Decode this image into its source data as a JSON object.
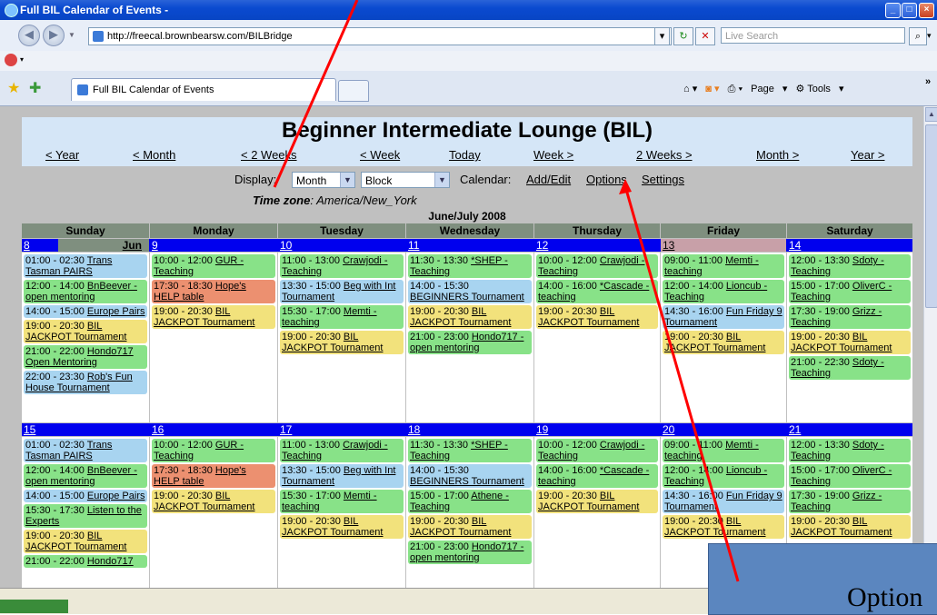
{
  "window": {
    "title": "Full BIL Calendar of Events -"
  },
  "address": {
    "url": "http://freecal.brownbearsw.com/BILBridge",
    "search_placeholder": "Live Search"
  },
  "tab": {
    "label": "Full BIL Calendar of Events"
  },
  "toolbar": {
    "page_label": "Page",
    "tools_label": "Tools"
  },
  "page": {
    "title": "Beginner Intermediate Lounge (BIL)",
    "nav": [
      "< Year",
      "< Month",
      "< 2 Weeks",
      "< Week",
      "Today",
      "Week >",
      "2 Weeks >",
      "Month >",
      "Year >"
    ],
    "display_label": "Display:",
    "display_value": "Month",
    "display_style": "Block",
    "calendar_label": "Calendar:",
    "calendar_links": [
      "Add/Edit",
      "Options",
      "Settings"
    ],
    "timezone_label": "Time zone",
    "timezone_value": ": America/New_York",
    "month_label": "June/July 2008",
    "day_names": [
      "Sunday",
      "Monday",
      "Tuesday",
      "Wednesday",
      "Thursday",
      "Friday",
      "Saturday"
    ]
  },
  "weeks": [
    {
      "dates": [
        "8",
        "9",
        "10",
        "11",
        "12",
        "13",
        "14"
      ],
      "month_tag": "Jun",
      "days": [
        [
          {
            "time": "01:00 - 02:30",
            "name": "Trans Tasman PAIRS",
            "color": "blue"
          },
          {
            "time": "12:00 - 14:00",
            "name": "BnBeever - open mentoring",
            "color": "green"
          },
          {
            "time": "14:00 - 15:00",
            "name": "Europe Pairs",
            "color": "blue"
          },
          {
            "time": "19:00 - 20:30",
            "name": "BIL JACKPOT Tournament",
            "color": "yellow"
          },
          {
            "time": "21:00 - 22:00",
            "name": "Hondo717 Open Mentoring",
            "color": "green"
          },
          {
            "time": "22:00 - 23:30",
            "name": "Rob's Fun House Tournament",
            "color": "blue"
          }
        ],
        [
          {
            "time": "10:00 - 12:00",
            "name": "GUR - Teaching",
            "color": "green"
          },
          {
            "time": "17:30 - 18:30",
            "name": "Hope's HELP table",
            "color": "salmon"
          },
          {
            "time": "19:00 - 20:30",
            "name": "BIL JACKPOT Tournament",
            "color": "yellow"
          }
        ],
        [
          {
            "time": "11:00 - 13:00",
            "name": "Crawjodi - Teaching",
            "color": "green"
          },
          {
            "time": "13:30 - 15:00",
            "name": "Beg with Int Tournament",
            "color": "blue"
          },
          {
            "time": "15:30 - 17:00",
            "name": "Memti - teaching",
            "color": "green"
          },
          {
            "time": "19:00 - 20:30",
            "name": "BIL JACKPOT Tournament",
            "color": "yellow"
          }
        ],
        [
          {
            "time": "11:30 - 13:30",
            "name": "*SHEP - Teaching",
            "color": "green"
          },
          {
            "time": "14:00 - 15:30",
            "name": "BEGINNERS Tournament",
            "color": "blue"
          },
          {
            "time": "19:00 - 20:30",
            "name": "BIL JACKPOT Tournament",
            "color": "yellow"
          },
          {
            "time": "21:00 - 23:00",
            "name": "Hondo717 - open mentoring",
            "color": "green"
          }
        ],
        [
          {
            "time": "10:00 - 12:00",
            "name": "Crawjodi - Teaching",
            "color": "green"
          },
          {
            "time": "14:00 - 16:00",
            "name": "*Cascade - teaching",
            "color": "green"
          },
          {
            "time": "19:00 - 20:30",
            "name": "BIL JACKPOT Tournament",
            "color": "yellow"
          }
        ],
        [
          {
            "time": "09:00 - 11:00",
            "name": "Memti - teaching",
            "color": "green"
          },
          {
            "time": "12:00 - 14:00",
            "name": "Lioncub - Teaching",
            "color": "green"
          },
          {
            "time": "14:30 - 16:00",
            "name": "Fun Friday 9 Tournament",
            "color": "blue"
          },
          {
            "time": "19:00 - 20:30",
            "name": "BIL JACKPOT Tournament",
            "color": "yellow"
          }
        ],
        [
          {
            "time": "12:00 - 13:30",
            "name": "Sdoty - Teaching",
            "color": "green"
          },
          {
            "time": "15:00 - 17:00",
            "name": "OliverC - Teaching",
            "color": "green"
          },
          {
            "time": "17:30 - 19:00",
            "name": "Grizz - Teaching",
            "color": "green"
          },
          {
            "time": "19:00 - 20:30",
            "name": "BIL JACKPOT Tournament",
            "color": "yellow"
          },
          {
            "time": "21:00 - 22:30",
            "name": "Sdoty - Teaching",
            "color": "green"
          }
        ]
      ]
    },
    {
      "dates": [
        "15",
        "16",
        "17",
        "18",
        "19",
        "20",
        "21"
      ],
      "days": [
        [
          {
            "time": "01:00 - 02:30",
            "name": "Trans Tasman PAIRS",
            "color": "blue"
          },
          {
            "time": "12:00 - 14:00",
            "name": "BnBeever - open mentoring",
            "color": "green"
          },
          {
            "time": "14:00 - 15:00",
            "name": "Europe Pairs",
            "color": "blue"
          },
          {
            "time": "15:30 - 17:30",
            "name": "Listen to the Experts",
            "color": "green"
          },
          {
            "time": "19:00 - 20:30",
            "name": "BIL JACKPOT Tournament",
            "color": "yellow"
          },
          {
            "time": "21:00 - 22:00",
            "name": "Hondo717",
            "color": "green"
          }
        ],
        [
          {
            "time": "10:00 - 12:00",
            "name": "GUR - Teaching",
            "color": "green"
          },
          {
            "time": "17:30 - 18:30",
            "name": "Hope's HELP table",
            "color": "salmon"
          },
          {
            "time": "19:00 - 20:30",
            "name": "BIL JACKPOT Tournament",
            "color": "yellow"
          }
        ],
        [
          {
            "time": "11:00 - 13:00",
            "name": "Crawjodi - Teaching",
            "color": "green"
          },
          {
            "time": "13:30 - 15:00",
            "name": "Beg with Int Tournament",
            "color": "blue"
          },
          {
            "time": "15:30 - 17:00",
            "name": "Memti - teaching",
            "color": "green"
          },
          {
            "time": "19:00 - 20:30",
            "name": "BIL JACKPOT Tournament",
            "color": "yellow"
          }
        ],
        [
          {
            "time": "11:30 - 13:30",
            "name": "*SHEP - Teaching",
            "color": "green"
          },
          {
            "time": "14:00 - 15:30",
            "name": "BEGINNERS Tournament",
            "color": "blue"
          },
          {
            "time": "15:00 - 17:00",
            "name": "Athene - Teaching",
            "color": "green"
          },
          {
            "time": "19:00 - 20:30",
            "name": "BIL JACKPOT Tournament",
            "color": "yellow"
          },
          {
            "time": "21:00 - 23:00",
            "name": "Hondo717 - open mentoring",
            "color": "green"
          }
        ],
        [
          {
            "time": "10:00 - 12:00",
            "name": "Crawjodi - Teaching",
            "color": "green"
          },
          {
            "time": "14:00 - 16:00",
            "name": "*Cascade - teaching",
            "color": "green"
          },
          {
            "time": "19:00 - 20:30",
            "name": "BIL JACKPOT Tournament",
            "color": "yellow"
          }
        ],
        [
          {
            "time": "09:00 - 11:00",
            "name": "Memti - teaching",
            "color": "green"
          },
          {
            "time": "12:00 - 14:00",
            "name": "Lioncub - Teaching",
            "color": "green"
          },
          {
            "time": "14:30 - 16:00",
            "name": "Fun Friday 9 Tournament",
            "color": "blue"
          },
          {
            "time": "19:00 - 20:30",
            "name": "BIL JACKPOT Tournament",
            "color": "yellow"
          }
        ],
        [
          {
            "time": "12:00 - 13:30",
            "name": "Sdoty - Teaching",
            "color": "green"
          },
          {
            "time": "15:00 - 17:00",
            "name": "OliverC - Teaching",
            "color": "green"
          },
          {
            "time": "17:30 - 19:00",
            "name": "Grizz - Teaching",
            "color": "green"
          },
          {
            "time": "19:00 - 20:30",
            "name": "BIL JACKPOT Tournament",
            "color": "yellow"
          }
        ]
      ]
    }
  ],
  "colors": {
    "green": "#88e288",
    "blue": "#a8d4f0",
    "yellow": "#f2e27c",
    "salmon": "#ec9070",
    "date_bar": "#0000ee",
    "annotation_arrow": "#ff0000"
  },
  "annotation": {
    "callout_text": "Option"
  }
}
